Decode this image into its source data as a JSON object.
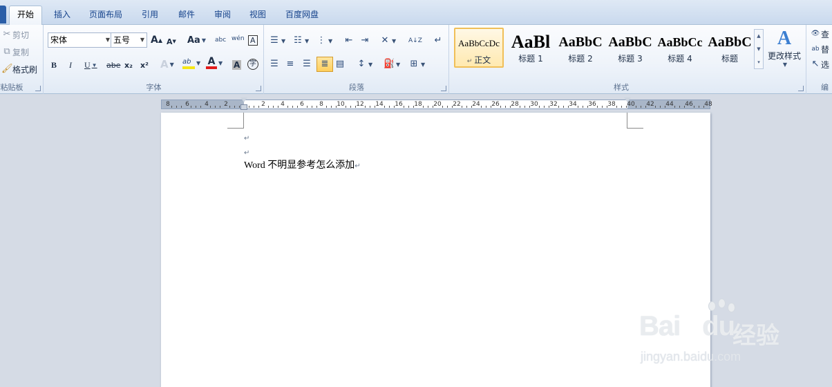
{
  "tabs": [
    {
      "label": "开始",
      "active": true
    },
    {
      "label": "插入"
    },
    {
      "label": "页面布局"
    },
    {
      "label": "引用"
    },
    {
      "label": "邮件"
    },
    {
      "label": "审阅"
    },
    {
      "label": "视图"
    },
    {
      "label": "百度网盘"
    }
  ],
  "clipboard": {
    "cut": "剪切",
    "copy": "复制",
    "format_painter": "格式刷",
    "label": "粘贴板"
  },
  "font": {
    "family": "宋体",
    "size": "五号",
    "grow": "A",
    "shrink": "A",
    "change_case": "Aa",
    "clear_format": "abc",
    "phonetic": "wén",
    "border_char": "A",
    "bold": "B",
    "italic": "I",
    "underline": "U",
    "strike": "abe",
    "subscript": "x₂",
    "superscript": "x²",
    "text_effect": "A",
    "highlight": "ab",
    "font_color": "A",
    "char_shade": "A",
    "enclose": "字",
    "label": "字体",
    "highlight_color": "#f5e616",
    "font_color_value": "#e21b1b"
  },
  "paragraph": {
    "label": "段落",
    "sort": "A↓Z",
    "show_marks": "↵"
  },
  "styles": {
    "label": "样式",
    "items": [
      {
        "sample": "AaBbCcDc",
        "name": "正文",
        "selected": true
      },
      {
        "sample": "AaBl",
        "name": "标题 1"
      },
      {
        "sample": "AaBbC",
        "name": "标题 2"
      },
      {
        "sample": "AaBbC",
        "name": "标题 3"
      },
      {
        "sample": "AaBbCc",
        "name": "标题 4"
      },
      {
        "sample": "AaBbC",
        "name": "标题"
      }
    ],
    "change_styles": "更改样式"
  },
  "editing": {
    "find": "查",
    "replace": "替",
    "select": "选",
    "label": "编"
  },
  "ruler": {
    "left_numbers": [
      "8",
      "6",
      "4",
      "2"
    ],
    "right_numbers": [
      "2",
      "4",
      "6",
      "8",
      "10",
      "12",
      "14",
      "16",
      "18",
      "20",
      "22",
      "24",
      "26",
      "28",
      "30",
      "32",
      "34",
      "36",
      "38",
      "40",
      "42",
      "44",
      "46",
      "48"
    ]
  },
  "document": {
    "lines": [
      "",
      "",
      "Word 不明显参考怎么添加"
    ],
    "para_mark": "↵"
  },
  "watermark": {
    "logo": "Bai",
    "logo2": "du",
    "cn": "经验",
    "url": "jingyan.baidu.com"
  }
}
